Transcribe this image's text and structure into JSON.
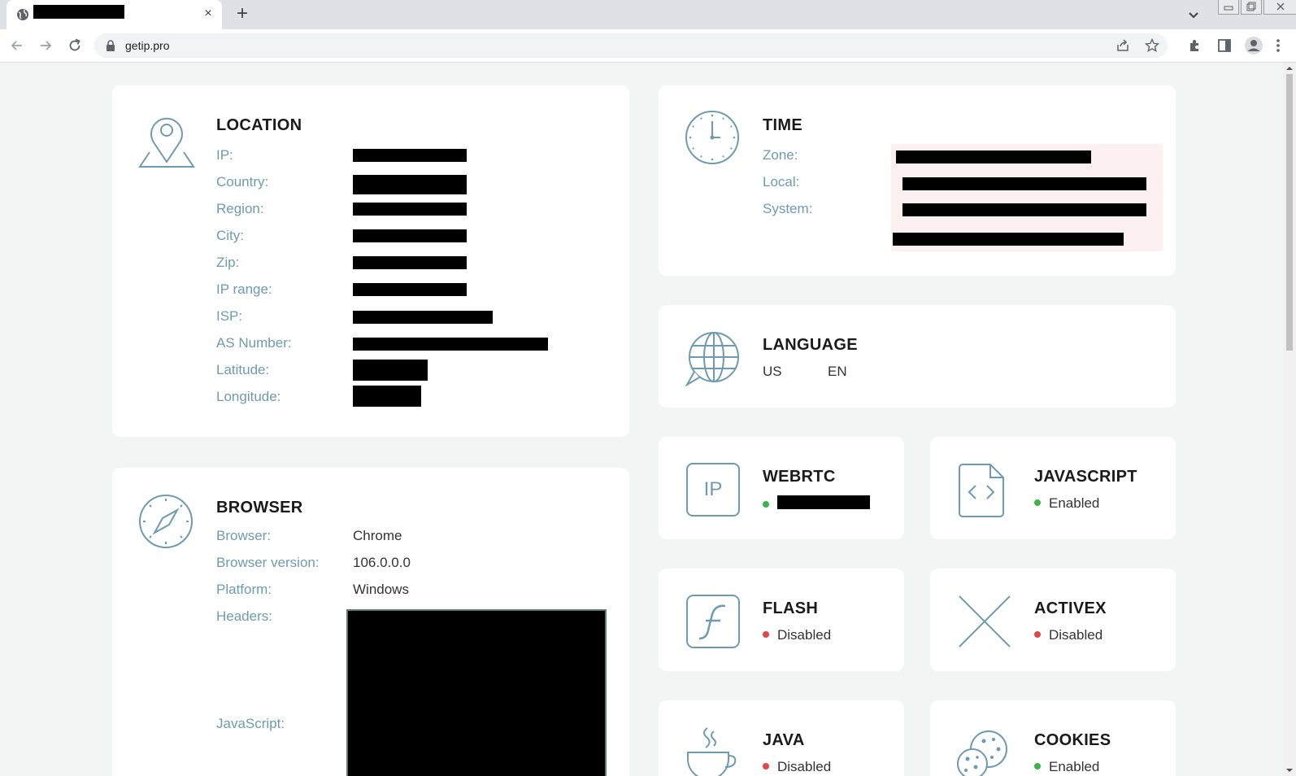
{
  "browser": {
    "url": "getip.pro",
    "new_tab_symbol": "+",
    "close_symbol": "×"
  },
  "location": {
    "title": "LOCATION",
    "labels": [
      "IP:",
      "Country:",
      "Region:",
      "City:",
      "Zip:",
      "IP range:",
      "ISP:",
      "AS Number:",
      "Latitude:",
      "Longitude:"
    ]
  },
  "time": {
    "title": "TIME",
    "labels": [
      "Zone:",
      "Local:",
      "System:"
    ]
  },
  "language": {
    "title": "LANGUAGE",
    "values": [
      "US",
      "EN"
    ]
  },
  "browser_info": {
    "title": "BROWSER",
    "labels": [
      "Browser:",
      "Browser version:",
      "Platform:",
      "Headers:",
      "JavaScript:"
    ],
    "values": [
      "Chrome",
      "106.0.0.0",
      "Windows"
    ]
  },
  "features": {
    "webrtc": {
      "title": "WEBRTC",
      "icon_text": "IP",
      "status_color": "#3db34a"
    },
    "javascript": {
      "title": "JAVASCRIPT",
      "status": "Enabled",
      "status_color": "#3db34a"
    },
    "flash": {
      "title": "FLASH",
      "status": "Disabled",
      "status_color": "#e04848"
    },
    "activex": {
      "title": "ACTIVEX",
      "status": "Disabled",
      "status_color": "#e04848"
    },
    "java": {
      "title": "JAVA",
      "status": "Disabled",
      "status_color": "#e04848"
    },
    "cookies": {
      "title": "COOKIES",
      "status": "Enabled",
      "status_color": "#3db34a"
    }
  },
  "colors": {
    "icon_stroke": "#6e9bb1",
    "label": "#6e9bb1",
    "card_bg": "#ffffff",
    "page_bg": "#f3f4f4",
    "time_highlight": "#fdf0f0"
  }
}
